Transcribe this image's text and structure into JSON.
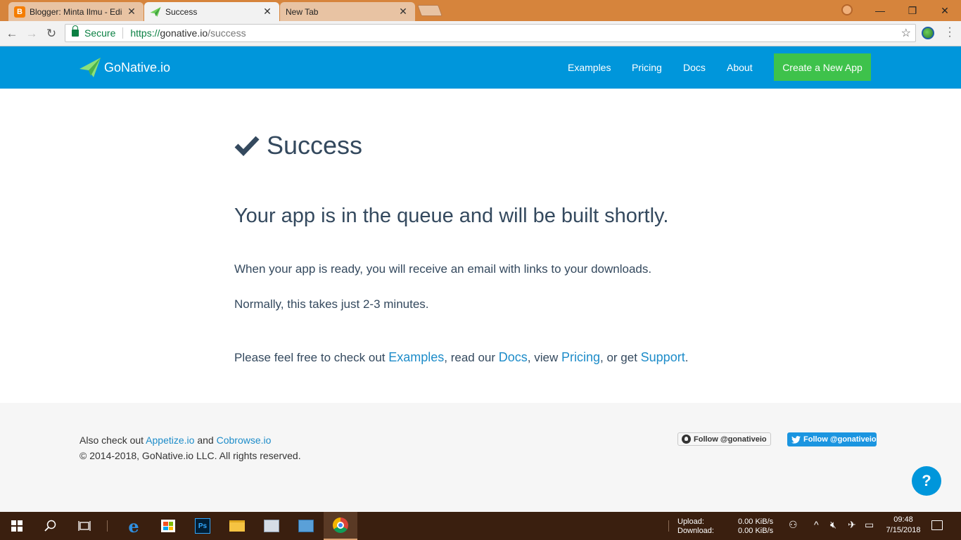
{
  "browser": {
    "tabs": [
      {
        "title": "Blogger: Minta Ilmu - Edi",
        "favicon": "blogger-icon",
        "active": false
      },
      {
        "title": "Success",
        "favicon": "gonative-plane-icon",
        "active": true
      },
      {
        "title": "New Tab",
        "favicon": "",
        "active": false
      }
    ],
    "secure_label": "Secure",
    "url_scheme": "https://",
    "url_host": "gonative.io",
    "url_path": "/success"
  },
  "header": {
    "brand": "GoNative.io",
    "nav": [
      "Examples",
      "Pricing",
      "Docs",
      "About"
    ],
    "cta": "Create a New App"
  },
  "main": {
    "title": "Success",
    "subtitle": "Your app is in the queue and will be built shortly.",
    "p1": "When your app is ready, you will receive an email with links to your downloads.",
    "p2": "Normally, this takes just 2-3 minutes.",
    "p3": {
      "prefix": "Please feel free to check out ",
      "link1": "Examples",
      "mid1": ", read our ",
      "link2": "Docs",
      "mid2": ", view ",
      "link3": "Pricing",
      "mid3": ", or get ",
      "link4": "Support",
      "suffix": "."
    }
  },
  "footer": {
    "also_prefix": "Also check out ",
    "appetize": "Appetize.io",
    "and": " and ",
    "cobrowse": "Cobrowse.io",
    "copyright": "© 2014-2018, GoNative.io LLC. All rights reserved.",
    "github_follow": "Follow @gonativeio",
    "twitter_follow": "Follow @gonativeio",
    "help": "?"
  },
  "taskbar": {
    "upload_label": "Upload:",
    "download_label": "Download:",
    "upload_value": "0.00 KiB/s",
    "download_value": "0.00 KiB/s",
    "time": "09:48",
    "date": "7/15/2018"
  },
  "colors": {
    "header_bg": "#0096db",
    "cta_bg": "#3ec24b",
    "text_dark": "#34495e",
    "link": "#1d8cc9",
    "titlebar": "#d6843c"
  }
}
